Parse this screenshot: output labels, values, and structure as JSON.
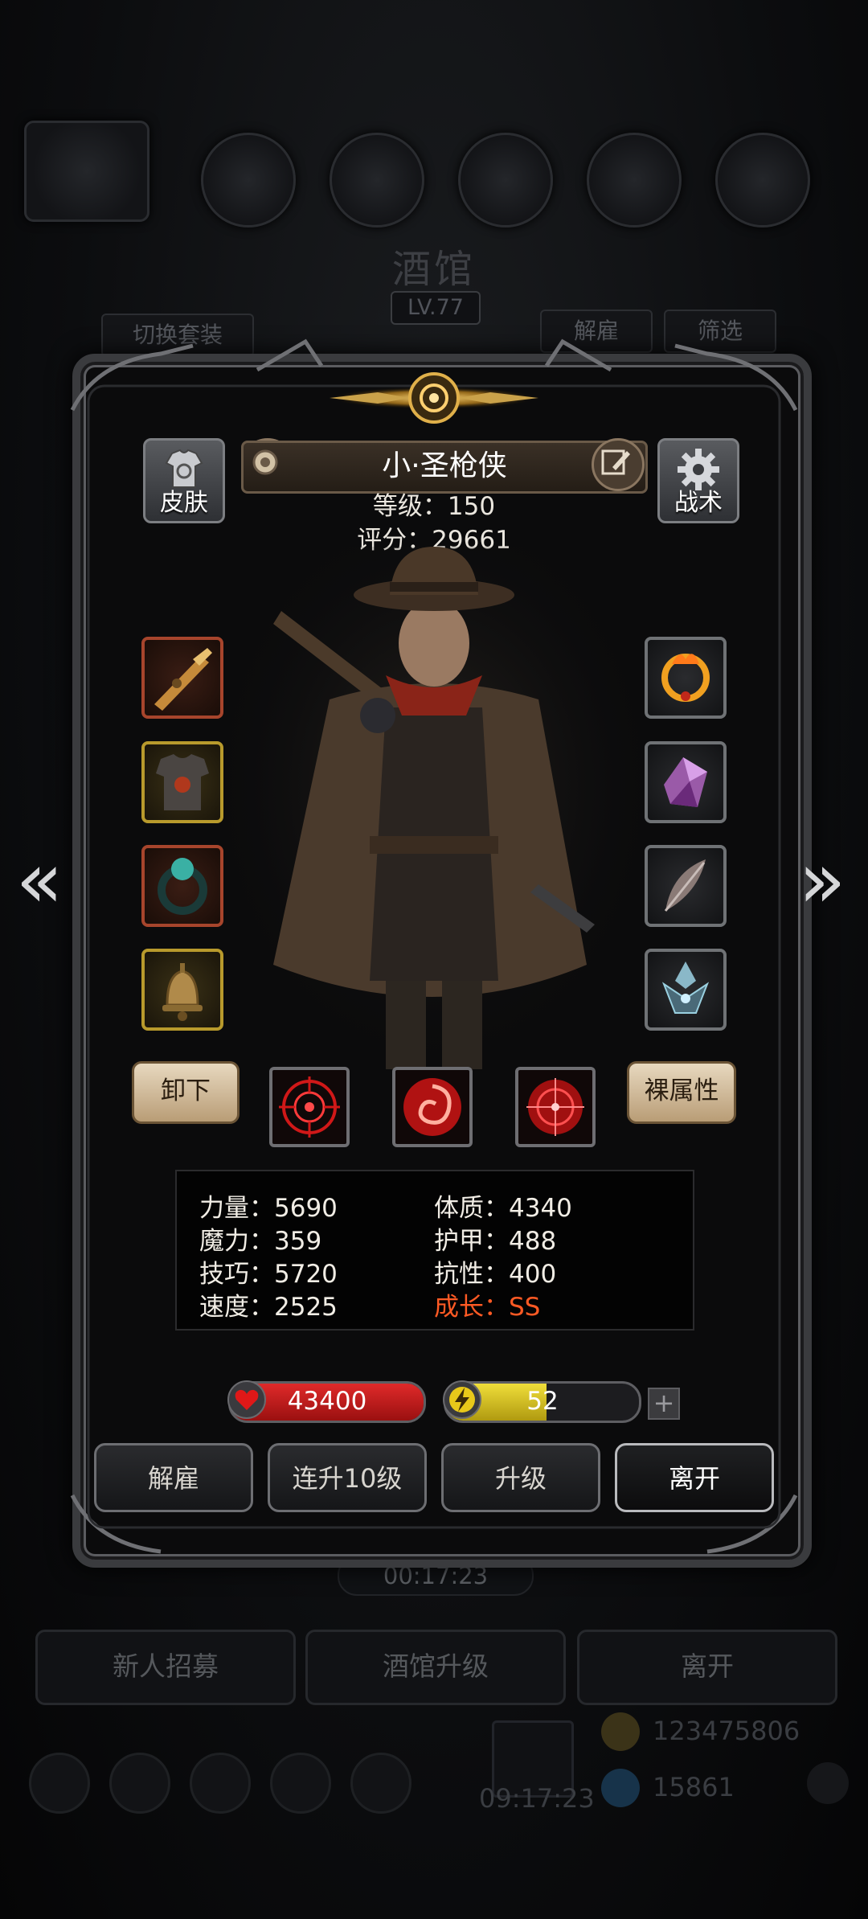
{
  "background": {
    "title": "酒馆",
    "level": "LV.77",
    "switch_outfit_label": "切换套装",
    "dismiss_label": "解雇",
    "filter_label": "筛选",
    "timer": "00:17:23",
    "bottom_buttons": [
      "新人招募",
      "酒馆升级",
      "离开"
    ],
    "gift_timer": "09:17:23",
    "gold": "123475806",
    "gems": "15861"
  },
  "hero": {
    "name": "小·圣枪侠",
    "level_text": "等级：150",
    "score_text": "评分：29661",
    "skin_label": "皮肤",
    "tactics_label": "战术"
  },
  "equipment": {
    "left": [
      {
        "icon": "rifle-icon",
        "rarity": "red"
      },
      {
        "icon": "armor-icon",
        "rarity": "gold"
      },
      {
        "icon": "ring-icon",
        "rarity": "red"
      },
      {
        "icon": "bell-icon",
        "rarity": "gold"
      }
    ],
    "right": [
      {
        "icon": "fire-ring-icon",
        "rarity": "grey"
      },
      {
        "icon": "crystal-icon",
        "rarity": "grey"
      },
      {
        "icon": "feather-icon",
        "rarity": "grey"
      },
      {
        "icon": "emblem-icon",
        "rarity": "grey"
      }
    ]
  },
  "controls": {
    "unequip_label": "卸下",
    "base_attr_label": "裸属性"
  },
  "skills": [
    "crosshair-skill-icon",
    "vortex-skill-icon",
    "target-skill-icon"
  ],
  "attributes": {
    "strength": "力量：5690",
    "constitution": "体质：4340",
    "magic": "魔力：359",
    "armor": "护甲：488",
    "skill": "技巧：5720",
    "resistance": "抗性：400",
    "speed": "速度：2525",
    "growth": "成长：SS"
  },
  "bars": {
    "hp": "43400",
    "energy": "52",
    "energy_fraction": 0.52,
    "plus": "+"
  },
  "actions": {
    "dismiss": "解雇",
    "level_up_10": "连升10级",
    "upgrade": "升级",
    "leave": "离开"
  },
  "colors": {
    "hp": "#c81a1a",
    "energy": "#d8c21a",
    "growth": "#ff5a24"
  }
}
